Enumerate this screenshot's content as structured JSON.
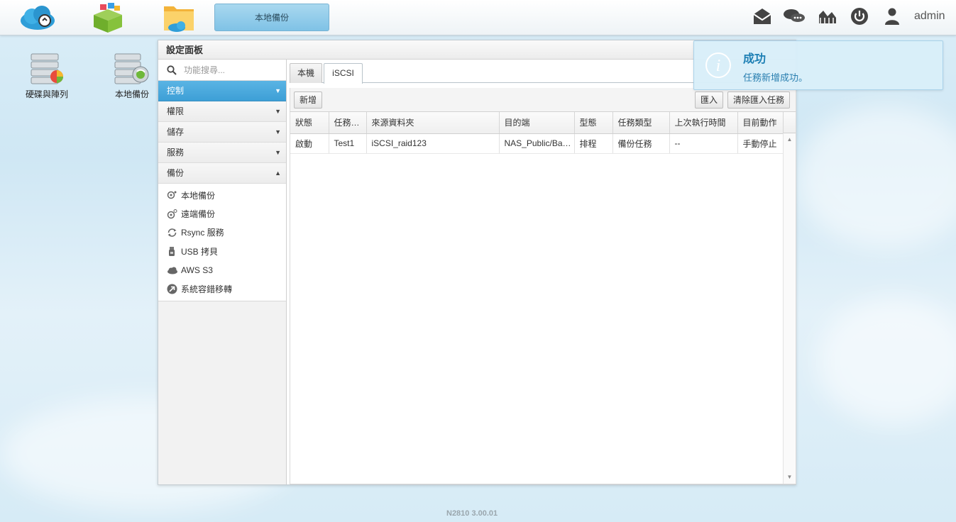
{
  "taskbar": {
    "active_task": "本地備份",
    "user": "admin"
  },
  "desktop": {
    "icons": [
      {
        "label": "硬碟與陣列"
      },
      {
        "label": "本地備份"
      }
    ]
  },
  "window": {
    "title": "設定面板",
    "search_placeholder": "功能搜尋...",
    "categories": [
      {
        "label": "控制",
        "arrow": "▼"
      },
      {
        "label": "權限",
        "arrow": "▼"
      },
      {
        "label": "儲存",
        "arrow": "▼"
      },
      {
        "label": "服務",
        "arrow": "▼"
      },
      {
        "label": "備份",
        "arrow": "▲"
      }
    ],
    "backup_items": [
      {
        "label": "本地備份",
        "icon": "local-backup-icon"
      },
      {
        "label": "遠端備份",
        "icon": "remote-backup-icon"
      },
      {
        "label": "Rsync 服務",
        "icon": "rsync-icon"
      },
      {
        "label": "USB 拷貝",
        "icon": "usb-icon"
      },
      {
        "label": "AWS S3",
        "icon": "cloud-icon"
      },
      {
        "label": "系統容錯移轉",
        "icon": "failover-icon"
      }
    ],
    "tabs": [
      {
        "label": "本機"
      },
      {
        "label": "iSCSI"
      }
    ],
    "toolbar": {
      "add": "新增",
      "import": "匯入",
      "clear_import": "清除匯入任務"
    },
    "table": {
      "headers": [
        "狀態",
        "任務名稱",
        "來源資料夾",
        "目的端",
        "型態",
        "任務類型",
        "上次執行時間",
        "目前動作"
      ],
      "rows": [
        [
          "啟動",
          "Test1",
          "iSCSI_raid123",
          "NAS_Public/Backup",
          "排程",
          "備份任務",
          "--",
          "手動停止"
        ]
      ]
    }
  },
  "notification": {
    "title": "成功",
    "message": "任務新增成功。"
  },
  "footer": {
    "version": "N2810   3.00.01"
  },
  "colors": {
    "accent": "#3d9fd6",
    "toast_bg": "#d8eef9",
    "toast_text": "#1d7fb4"
  }
}
